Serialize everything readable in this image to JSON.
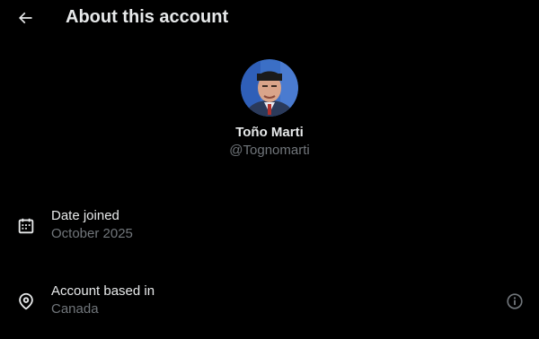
{
  "header": {
    "title": "About this account",
    "back_icon": "arrow-left-icon"
  },
  "profile": {
    "display_name": "Toño Marti",
    "handle": "@Tognomarti"
  },
  "details": {
    "date_joined": {
      "label": "Date joined",
      "value": "October 2025",
      "icon": "calendar-icon"
    },
    "based_in": {
      "label": "Account based in",
      "value": "Canada",
      "icon": "location-pin-icon",
      "info_icon": "info-icon"
    }
  },
  "colors": {
    "background": "#000000",
    "primary_text": "#e7e9ea",
    "secondary_text": "#71767b"
  }
}
